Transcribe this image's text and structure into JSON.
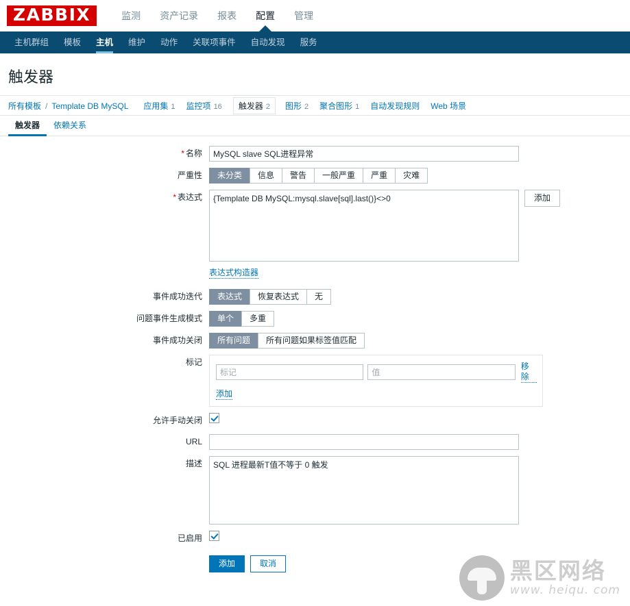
{
  "header": {
    "logo_text": "ZABBIX",
    "logo_bg": "#d40000",
    "menu": [
      {
        "label": "监测",
        "active": false
      },
      {
        "label": "资产记录",
        "active": false
      },
      {
        "label": "报表",
        "active": false
      },
      {
        "label": "配置",
        "active": true
      },
      {
        "label": "管理",
        "active": false
      }
    ]
  },
  "subnav": {
    "bg": "#0a4b72",
    "items": [
      {
        "label": "主机群组",
        "active": false
      },
      {
        "label": "模板",
        "active": false
      },
      {
        "label": "主机",
        "active": true
      },
      {
        "label": "维护",
        "active": false
      },
      {
        "label": "动作",
        "active": false
      },
      {
        "label": "关联项事件",
        "active": false
      },
      {
        "label": "自动发现",
        "active": false
      },
      {
        "label": "服务",
        "active": false
      }
    ]
  },
  "page": {
    "title": "触发器"
  },
  "breadcrumb": {
    "root_label": "所有模板",
    "separator": "/",
    "template_label": "Template DB MySQL",
    "items": [
      {
        "label": "应用集",
        "count": "1",
        "selected": false
      },
      {
        "label": "监控项",
        "count": "16",
        "selected": false
      },
      {
        "label": "触发器",
        "count": "2",
        "selected": true
      },
      {
        "label": "图形",
        "count": "2",
        "selected": false
      },
      {
        "label": "聚合图形",
        "count": "1",
        "selected": false
      },
      {
        "label": "自动发现规则",
        "count": "",
        "selected": false
      },
      {
        "label": "Web 场景",
        "count": "",
        "selected": false
      }
    ]
  },
  "tabs": [
    {
      "label": "触发器",
      "active": true
    },
    {
      "label": "依赖关系",
      "active": false
    }
  ],
  "form": {
    "name": {
      "label": "名称",
      "required": true,
      "value": "MySQL slave SQL进程异常",
      "placeholder": ""
    },
    "severity": {
      "label": "严重性",
      "options": [
        "未分类",
        "信息",
        "警告",
        "一般严重",
        "严重",
        "灾难"
      ],
      "selected": "未分类"
    },
    "expression": {
      "label": "表达式",
      "required": true,
      "value": "{Template DB MySQL:mysql.slave[sql].last()}<>0",
      "add_button": "添加",
      "constructor_link": "表达式构造器"
    },
    "ok_event_generation": {
      "label": "事件成功迭代",
      "options": [
        "表达式",
        "恢复表达式",
        "无"
      ],
      "selected": "表达式"
    },
    "problem_event_mode": {
      "label": "问题事件生成模式",
      "options": [
        "单个",
        "多重"
      ],
      "selected": "单个"
    },
    "ok_event_closes": {
      "label": "事件成功关闭",
      "options": [
        "所有问题",
        "所有问题如果标签值匹配"
      ],
      "selected": "所有问题"
    },
    "tags": {
      "label": "标记",
      "tag_placeholder": "标记",
      "tag_value": "",
      "value_placeholder": "值",
      "value_value": "",
      "remove_link": "移除",
      "add_link": "添加"
    },
    "allow_manual_close": {
      "label": "允许手动关闭",
      "checked": true
    },
    "url": {
      "label": "URL",
      "value": "",
      "placeholder": ""
    },
    "description": {
      "label": "描述",
      "value": "SQL 进程最新T值不等于 0 触发"
    },
    "enabled": {
      "label": "已启用",
      "checked": true
    },
    "actions": {
      "submit_label": "添加",
      "cancel_label": "取消"
    }
  },
  "watermark": {
    "brand_cn": "黑区网络",
    "url": "www. heiqu. com"
  }
}
